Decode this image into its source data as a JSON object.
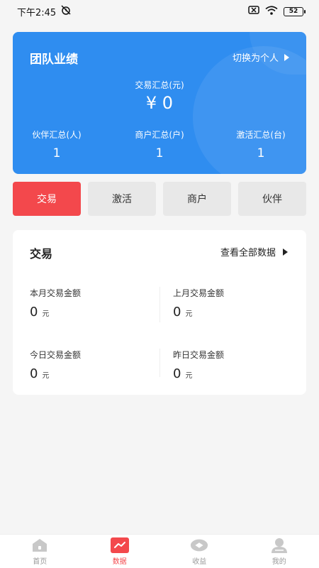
{
  "status_bar": {
    "time": "下午2:45",
    "battery": "52"
  },
  "team_card": {
    "title": "团队业绩",
    "switch_label": "切换为个人",
    "total_label": "交易汇总(元)",
    "total_value": "¥ 0",
    "stats": [
      {
        "label": "伙伴汇总(人)",
        "value": "1"
      },
      {
        "label": "商户汇总(户)",
        "value": "1"
      },
      {
        "label": "激活汇总(台)",
        "value": "1"
      }
    ]
  },
  "tabs": [
    {
      "label": "交易",
      "active": true
    },
    {
      "label": "激活",
      "active": false
    },
    {
      "label": "商户",
      "active": false
    },
    {
      "label": "伙伴",
      "active": false
    }
  ],
  "trade_card": {
    "title": "交易",
    "view_all_label": "查看全部数据",
    "cells": [
      {
        "label": "本月交易金额",
        "value": "0",
        "unit": "元"
      },
      {
        "label": "上月交易金额",
        "value": "0",
        "unit": "元"
      },
      {
        "label": "今日交易金额",
        "value": "0",
        "unit": "元"
      },
      {
        "label": "昨日交易金额",
        "value": "0",
        "unit": "元"
      }
    ]
  },
  "bottom_nav": [
    {
      "label": "首页",
      "icon": "home-icon",
      "active": false
    },
    {
      "label": "数据",
      "icon": "chart-icon",
      "active": true
    },
    {
      "label": "收益",
      "icon": "eye-icon",
      "active": false
    },
    {
      "label": "我的",
      "icon": "user-icon",
      "active": false
    }
  ],
  "colors": {
    "accent_red": "#f3484c",
    "card_blue": "#2f8df0"
  }
}
